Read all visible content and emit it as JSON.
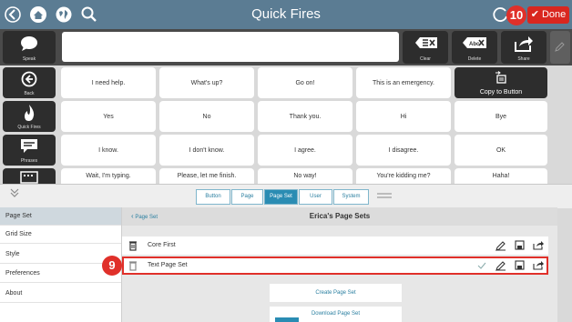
{
  "header": {
    "title": "Quick Fires",
    "done_label": "Done",
    "step_badge": "10"
  },
  "toolbar": {
    "speak_label": "Speak",
    "clear_label": "Clear",
    "clear_icon_text": "",
    "delete_label": "Delete",
    "delete_icon_text": "Abc",
    "share_label": "Share"
  },
  "left_column": [
    {
      "label": "Back"
    },
    {
      "label": "Quick Fires"
    },
    {
      "label": "Phrases"
    },
    {
      "label": ""
    }
  ],
  "grid": {
    "row1": [
      "I need help.",
      "What's up?",
      "Go on!",
      "This is an emergency.",
      "Copy to Button"
    ],
    "row2": [
      "Yes",
      "No",
      "Thank you.",
      "Hi",
      "Bye"
    ],
    "row3": [
      "I know.",
      "I don't know.",
      "I agree.",
      "I disagree.",
      "OK"
    ],
    "row4": [
      "Wait, I'm typing.",
      "Please, let me finish.",
      "No way!",
      "You're kidding me?",
      "Haha!"
    ]
  },
  "tabs": [
    "Button",
    "Page",
    "Page Set",
    "User",
    "System"
  ],
  "active_tab": "Page Set",
  "sidebar": [
    "Page Set",
    "Grid Size",
    "Style",
    "Preferences",
    "About"
  ],
  "content": {
    "breadcrumb": "Page Set",
    "heading": "Erica's Page Sets",
    "page_sets": [
      "Core First",
      "Text Page Set"
    ],
    "step_badge": "9",
    "create_label": "Create Page Set",
    "download_label": "Download Page Set"
  },
  "colors": {
    "topbar": "#5b7c93",
    "accent": "#2a8cb3",
    "highlight": "#e0302a"
  }
}
